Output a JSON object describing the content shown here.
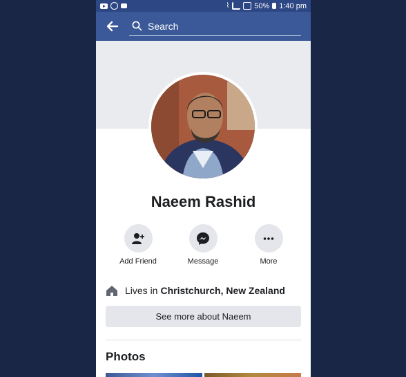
{
  "status_bar": {
    "battery": "50%",
    "time": "1:40 pm",
    "icons": [
      "youtube-icon",
      "whatsapp-icon",
      "message-icon",
      "wifi-icon",
      "signal-icon",
      "battery-icon"
    ]
  },
  "header": {
    "search_placeholder": "Search",
    "brand_color": "#3b5998"
  },
  "profile": {
    "name": "Naeem Rashid"
  },
  "actions": [
    {
      "label": "Add Friend",
      "icon": "add-friend-icon"
    },
    {
      "label": "Message",
      "icon": "messenger-icon"
    },
    {
      "label": "More",
      "icon": "more-icon"
    }
  ],
  "info": {
    "lives_prefix": "Lives in",
    "lives_place": "Christchurch, New Zealand",
    "see_more_label": "See more about Naeem"
  },
  "photos": {
    "title": "Photos"
  }
}
